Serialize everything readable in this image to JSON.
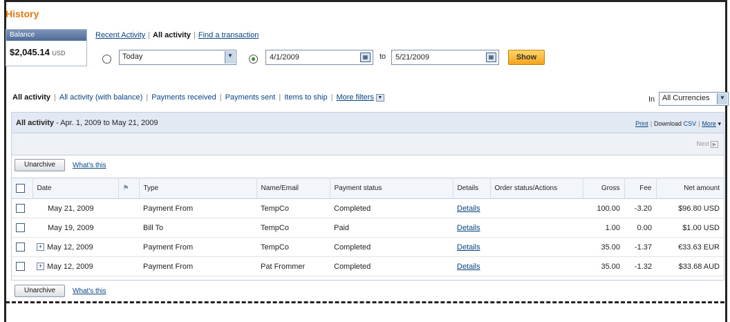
{
  "page": {
    "title": "History"
  },
  "balance": {
    "label": "Balance",
    "amount": "$2,045.14",
    "currency": "USD"
  },
  "top_links": {
    "recent": "Recent Activity",
    "all": "All activity",
    "find": "Find a transaction"
  },
  "date_filter": {
    "preset": "Today",
    "from": "4/1/2009",
    "to_label": "to",
    "to": "5/21/2009",
    "show_label": "Show"
  },
  "filter_tabs": {
    "all": "All activity",
    "all_balance": "All activity (with balance)",
    "received": "Payments received",
    "sent": "Payments sent",
    "ship": "Items to ship",
    "more": "More filters"
  },
  "currency_filter": {
    "label": "In",
    "value": "All Currencies"
  },
  "panel": {
    "title_bold": "All activity",
    "title_rest": " - Apr. 1, 2009 to May 21, 2009",
    "print": "Print",
    "download": "Download",
    "csv": "CSV",
    "more": "More",
    "next": "Next"
  },
  "actions": {
    "unarchive": "Unarchive",
    "whats_this": "What's this"
  },
  "table": {
    "headers": {
      "date": "Date",
      "type": "Type",
      "name": "Name/Email",
      "status": "Payment status",
      "details": "Details",
      "order": "Order status/Actions",
      "gross": "Gross",
      "fee": "Fee",
      "net": "Net amount"
    },
    "rows": [
      {
        "date": "May 21, 2009",
        "type": "Payment From",
        "name": "TempCo",
        "status": "Completed",
        "details": "Details",
        "gross": "100.00",
        "fee": "-3.20",
        "net": "$96.80 USD"
      },
      {
        "date": "May 19, 2009",
        "type": "Bill To",
        "name": "TempCo",
        "status": "Paid",
        "details": "Details",
        "gross": "1.00",
        "fee": "0.00",
        "net": "$1.00 USD"
      },
      {
        "date": "May 12, 2009",
        "type": "Payment From",
        "name": "TempCo",
        "status": "Completed",
        "details": "Details",
        "gross": "35.00",
        "fee": "-1.37",
        "net": "€33.63 EUR"
      },
      {
        "date": "May 12, 2009",
        "type": "Payment From",
        "name": "Pat Frommer",
        "status": "Completed",
        "details": "Details",
        "gross": "35.00",
        "fee": "-1.32",
        "net": "$33.68 AUD"
      }
    ]
  },
  "colors": {
    "title": "#e77812",
    "link": "#084482",
    "show_button": "#f5a21b"
  }
}
